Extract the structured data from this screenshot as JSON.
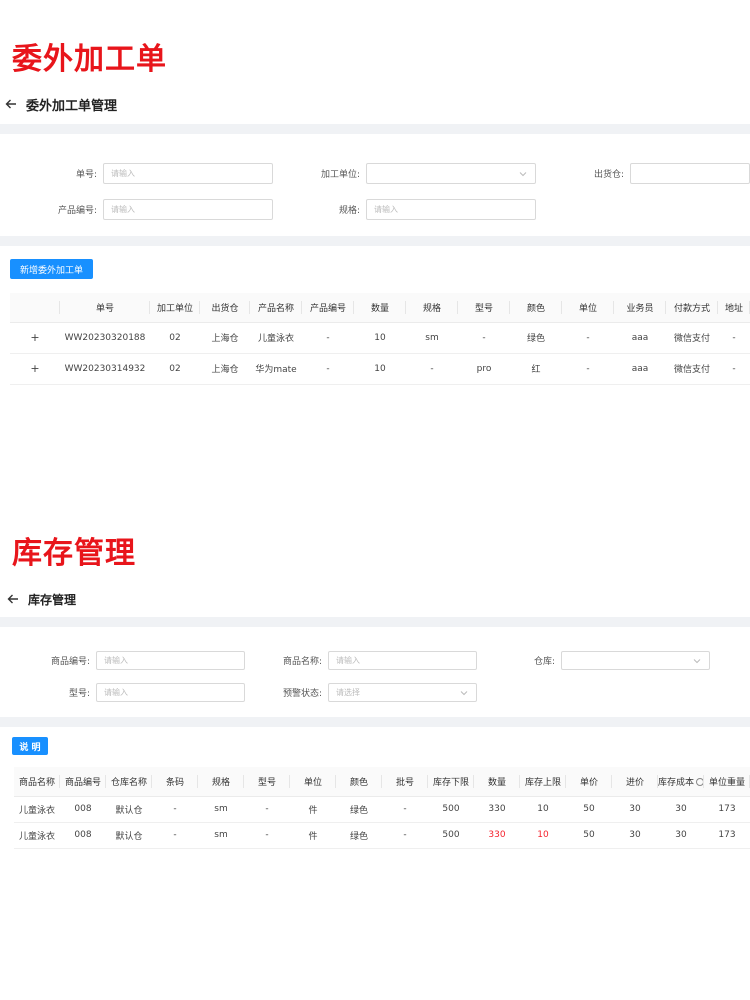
{
  "section1": {
    "heading": "委外加工单",
    "page_title": "委外加工单管理",
    "filters": [
      {
        "label": "单号:",
        "placeholder": "请输入",
        "type": "input"
      },
      {
        "label": "加工单位:",
        "placeholder": "",
        "type": "select"
      },
      {
        "label": "出货仓:",
        "placeholder": "",
        "type": "select"
      },
      {
        "label": "产品编号:",
        "placeholder": "请输入",
        "type": "input"
      },
      {
        "label": "规格:",
        "placeholder": "请输入",
        "type": "input"
      }
    ],
    "add_button": "新增委外加工单",
    "columns": [
      "",
      "单号",
      "加工单位",
      "出货仓",
      "产品名称",
      "产品编号",
      "数量",
      "规格",
      "型号",
      "颜色",
      "单位",
      "业务员",
      "付款方式",
      "地址"
    ],
    "rows": [
      [
        "+",
        "WW20230320188",
        "02",
        "上海仓",
        "儿童泳衣",
        "-",
        "10",
        "sm",
        "-",
        "绿色",
        "-",
        "aaa",
        "微信支付",
        "-"
      ],
      [
        "+",
        "WW20230314932",
        "02",
        "上海仓",
        "华为mate",
        "-",
        "10",
        "-",
        "pro",
        "红",
        "-",
        "aaa",
        "微信支付",
        "-"
      ]
    ]
  },
  "section2": {
    "heading": "库存管理",
    "page_title": "库存管理",
    "filters": [
      {
        "label": "商品编号:",
        "placeholder": "请输入",
        "type": "input"
      },
      {
        "label": "商品名称:",
        "placeholder": "请输入",
        "type": "input"
      },
      {
        "label": "仓库:",
        "placeholder": "",
        "type": "select"
      },
      {
        "label": "型号:",
        "placeholder": "请输入",
        "type": "input"
      },
      {
        "label": "预警状态:",
        "placeholder": "请选择",
        "type": "select"
      }
    ],
    "explain_button": "说 明",
    "columns": [
      "商品名称",
      "商品编号",
      "仓库名称",
      "条码",
      "规格",
      "型号",
      "单位",
      "颜色",
      "批号",
      "库存下限",
      "数量",
      "库存上限",
      "单价",
      "进价",
      "库存成本",
      "单位重量"
    ],
    "rows": [
      [
        "儿童泳衣",
        "008",
        "默认仓",
        "-",
        "sm",
        "-",
        "件",
        "绿色",
        "-",
        "500",
        "330",
        "10",
        "50",
        "30",
        "30",
        "173"
      ],
      [
        "儿童泳衣",
        "008",
        "默认仓",
        "-",
        "sm",
        "-",
        "件",
        "绿色",
        "-",
        "500",
        "330",
        "10",
        "50",
        "30",
        "30",
        "173"
      ]
    ],
    "alert_cells": [
      [
        1,
        10
      ],
      [
        1,
        11
      ]
    ]
  },
  "colors": {
    "heading_red": "#e8151b",
    "primary": "#1890ff",
    "alert": "#f5222d",
    "gap": "#f0f2f5"
  }
}
